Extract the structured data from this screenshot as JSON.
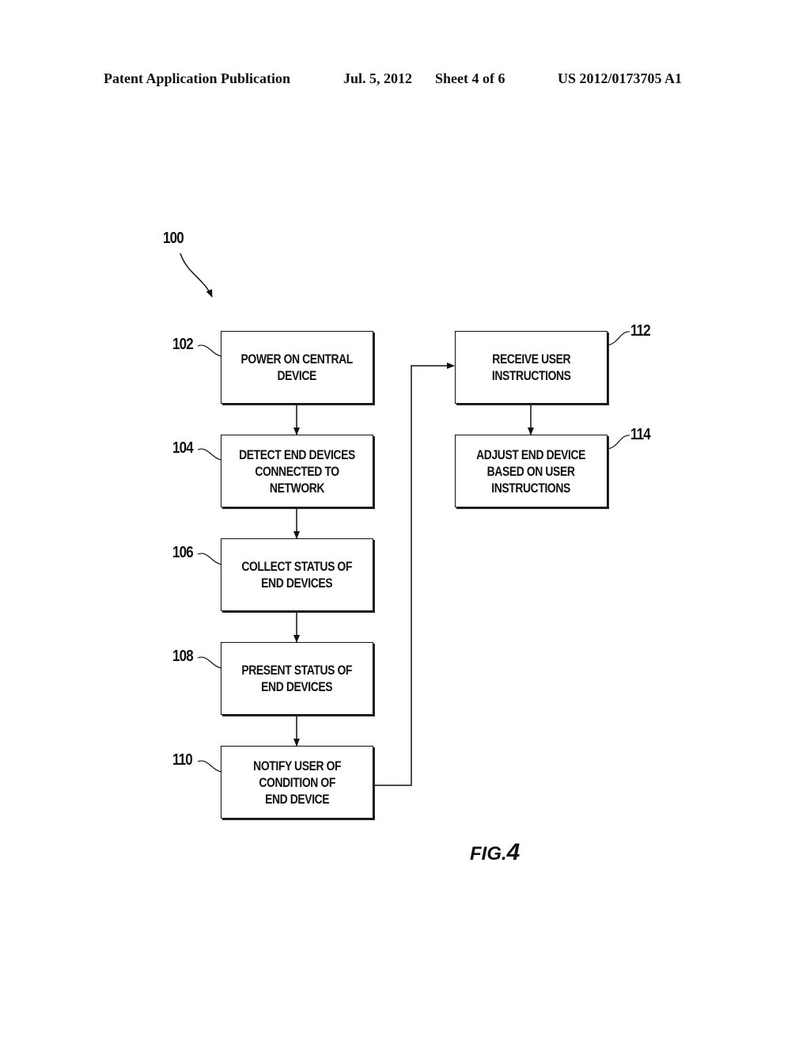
{
  "header": {
    "publication": "Patent Application Publication",
    "date": "Jul. 5, 2012",
    "sheet": "Sheet 4 of 6",
    "number": "US 2012/0173705 A1"
  },
  "diagram": {
    "reference": "100",
    "figure_label": "FIG.",
    "figure_number": "4",
    "steps": [
      {
        "ref": "102",
        "text": "POWER ON CENTRAL\nDEVICE"
      },
      {
        "ref": "104",
        "text": "DETECT END DEVICES\nCONNECTED TO\nNETWORK"
      },
      {
        "ref": "106",
        "text": "COLLECT STATUS OF\nEND DEVICES"
      },
      {
        "ref": "108",
        "text": "PRESENT STATUS OF\nEND DEVICES"
      },
      {
        "ref": "110",
        "text": "NOTIFY USER OF\nCONDITION OF\nEND DEVICE"
      },
      {
        "ref": "112",
        "text": "RECEIVE USER\nINSTRUCTIONS"
      },
      {
        "ref": "114",
        "text": "ADJUST END DEVICE\nBASED ON USER\nINSTRUCTIONS"
      }
    ],
    "flow": [
      [
        "102",
        "104"
      ],
      [
        "104",
        "106"
      ],
      [
        "106",
        "108"
      ],
      [
        "108",
        "110"
      ],
      [
        "110",
        "112"
      ],
      [
        "112",
        "114"
      ]
    ]
  }
}
